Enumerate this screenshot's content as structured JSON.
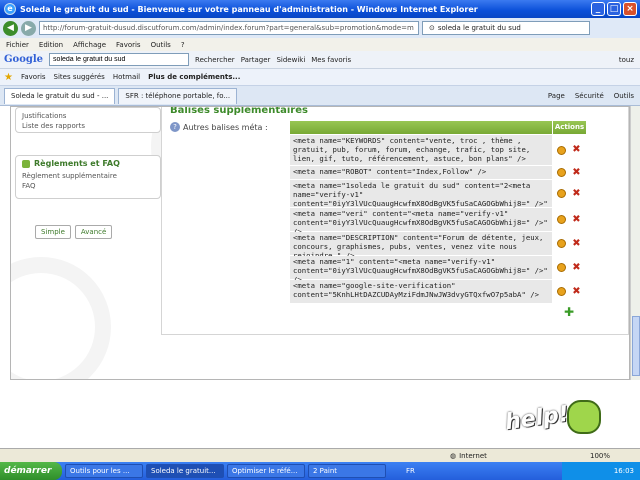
{
  "window": {
    "title": "Soleda le gratuit du sud - Bienvenue sur votre panneau d'administration - Windows Internet Explorer"
  },
  "address": {
    "url": "http://forum-gratuit-dusud.discutforum.com/admin/index.forum?part=general&sub=promotion&mode=m",
    "search_value": "soleda le gratuit du sud"
  },
  "menu": [
    "Fichier",
    "Edition",
    "Affichage",
    "Favoris",
    "Outils",
    "?"
  ],
  "googlebar": {
    "logo": "Google",
    "search_value": "soleda le gratuit du sud",
    "rechercher": "Rechercher",
    "partager": "Partager",
    "sidewiki": "Sidewiki",
    "favoris": "Mes favoris",
    "user": "touz"
  },
  "favbar": {
    "favoris": "Favoris",
    "sites": "Sites suggérés",
    "hotmail": "Hotmail",
    "more": "Plus de compléments..."
  },
  "tabs": [
    {
      "label": "Soleda le gratuit du sud - ..."
    },
    {
      "label": "SFR : téléphone portable, fo..."
    }
  ],
  "tabtools": {
    "page": "Page",
    "securite": "Sécurité",
    "outils": "Outils"
  },
  "sidebar": {
    "links_top": [
      "Justifications",
      "Liste des rapports"
    ],
    "rules_title": "Règlements et FAQ",
    "rules_links": [
      "Règlement supplémentaire",
      "FAQ"
    ],
    "mode_simple": "Simple",
    "mode_advanced": "Avancé"
  },
  "main": {
    "section_title": "Balises supplémentaires",
    "meta_label": "Autres balises méta :",
    "actions_header": "Actions",
    "rows": [
      "<meta name=\"KEYWORDS\" content=\"vente, troc , thème , gratuit, pub, forum, forum, echange, trafic, top site, lien, gif, tuto, référencement, astuce, bon plans\" />",
      "<meta name=\"ROBOT\" content=\"Index,Follow\" />",
      "<meta name=\"1soleda le gratuit du sud\" content=\"2<meta name=\"verify-v1\" content=\"0iyY3lVUcQuaugHcwfmX8OdBgVK5fuSaCAGOGbWhij8=\" />\" />",
      "<meta name=\"veri\" content=\"<meta name=\"verify-v1\" content=\"0iyY3lVUcQuaugHcwfmX8OdBgVK5fuSaCAGOGbWhij8=\" />\" />",
      "<meta name=\"DESCRIPTION\" content=\"Forum de détente, jeux, concours, graphismes, pubs, ventes, venez vite nous rejoindre.\" />",
      "<meta name=\"1\" content=\"<meta name=\"verify-v1\" content=\"0iyY3lVUcQuaugHcwfmX8OdBgVK5fuSaCAGOGbWhij8=\" />\" />",
      "<meta name=\"google-site-verification\" content=\"5KnhLHtDAZCUDAyMziFdmJNwJW3dvyGTQxfwO7p5abA\" />"
    ]
  },
  "status": {
    "zone": "Internet",
    "zoom": "100%"
  },
  "help_badge": "help!",
  "taskbar": {
    "start": "démarrer",
    "tasks": [
      "Outils pour les ...",
      "Soleda le gratuit...",
      "Optimiser le réfé...",
      "2 Paint"
    ],
    "lang": "FR",
    "clock": "16:03"
  }
}
